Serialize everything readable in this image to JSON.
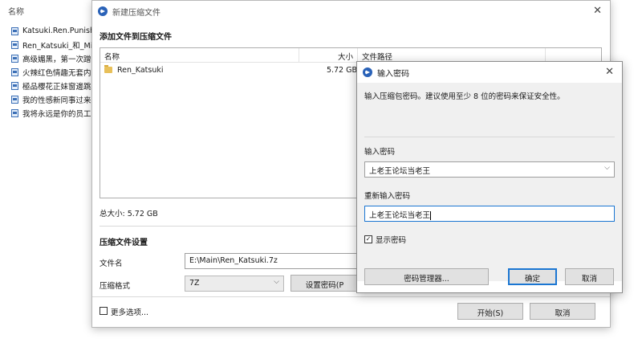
{
  "explorer": {
    "header": "名称",
    "files": [
      "Katsuki.Ren.Punishe",
      "Ren_Katsuki_和_Mil",
      "高级媚黑，第一次蹭",
      "火辣红色情趣无套内",
      "極品櫻花正妹窗邊跳",
      "我的性感新同事过来",
      "我将永远是你的员工"
    ]
  },
  "archive_dialog": {
    "title": "新建压缩文件",
    "close_glyph": "✕",
    "add_files_label": "添加文件到压缩文件",
    "columns": {
      "name": "名称",
      "size": "大小",
      "path": "文件路径"
    },
    "rows": [
      {
        "name": "Ren_Katsuki",
        "size": "5.72 GB",
        "path": ""
      }
    ],
    "total_size": "总大小: 5.72 GB",
    "settings_label": "压缩文件设置",
    "filename_label": "文件名",
    "filename_value": "E:\\Main\\Ren_Katsuki.7z",
    "format_label": "压缩格式",
    "format_value": "7Z",
    "set_password_button": "设置密码(P",
    "more_options_label": "更多选项...",
    "start_button": "开始(S)",
    "cancel_button": "取消"
  },
  "password_dialog": {
    "title": "输入密码",
    "close_glyph": "✕",
    "hint": "输入压缩包密码。建议使用至少 8 位的密码来保证安全性。",
    "password_label": "输入密码",
    "password_value": "上老王论坛当老王",
    "reenter_label": "重新输入密码",
    "reenter_value": "上老王论坛当老王",
    "show_password_label": "显示密码",
    "show_password_checked": true,
    "password_manager_button": "密码管理器...",
    "ok_button": "确定",
    "cancel_button": "取消"
  },
  "colors": {
    "accent": "#1b76d2",
    "app_icon": "#2a62b8",
    "folder": "#e8c05a",
    "file_icon": "#3b6fb6"
  }
}
